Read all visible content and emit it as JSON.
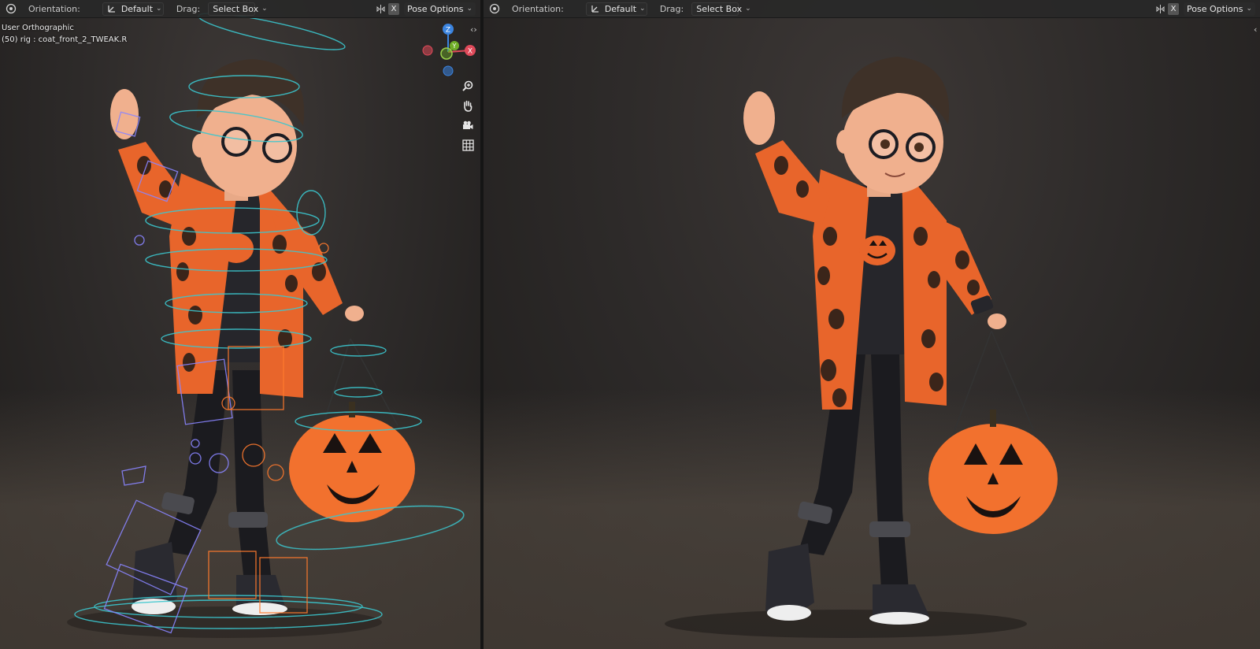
{
  "left_viewport": {
    "header": {
      "orientation_label": "Orientation:",
      "orientation_value": "Default",
      "drag_label": "Drag:",
      "drag_value": "Select Box",
      "x_toggle": "X",
      "pose_options": "Pose Options"
    },
    "view_name": "User Orthographic",
    "active_object": "(50) rig : coat_front_2_TWEAK.R",
    "gizmo": {
      "z": "Z",
      "y": "Y",
      "x": "X"
    }
  },
  "right_viewport": {
    "header": {
      "orientation_label": "Orientation:",
      "orientation_value": "Default",
      "drag_label": "Drag:",
      "drag_value": "Select Box",
      "x_toggle": "X",
      "pose_options": "Pose Options"
    }
  },
  "icons": {
    "header_menu": "transform-pivot-icon",
    "orientation": "orientation-gizmo-icon",
    "mirror": "mirror-pose-icon",
    "zoom": "zoom-icon",
    "pan": "hand-pan-icon",
    "camera": "camera-view-icon",
    "grid": "ortho-grid-icon",
    "collapse": "collapse-arrows-icon"
  },
  "colors": {
    "coat_orange": "#e8652b",
    "pumpkin_orange": "#f2712e",
    "rig_cyan": "#3cc7cf",
    "rig_violet": "#8a85ff",
    "rig_orange": "#ff7a2e",
    "axis_x": "#e04a5a",
    "axis_y": "#6fae27",
    "axis_z": "#3b84e0"
  }
}
